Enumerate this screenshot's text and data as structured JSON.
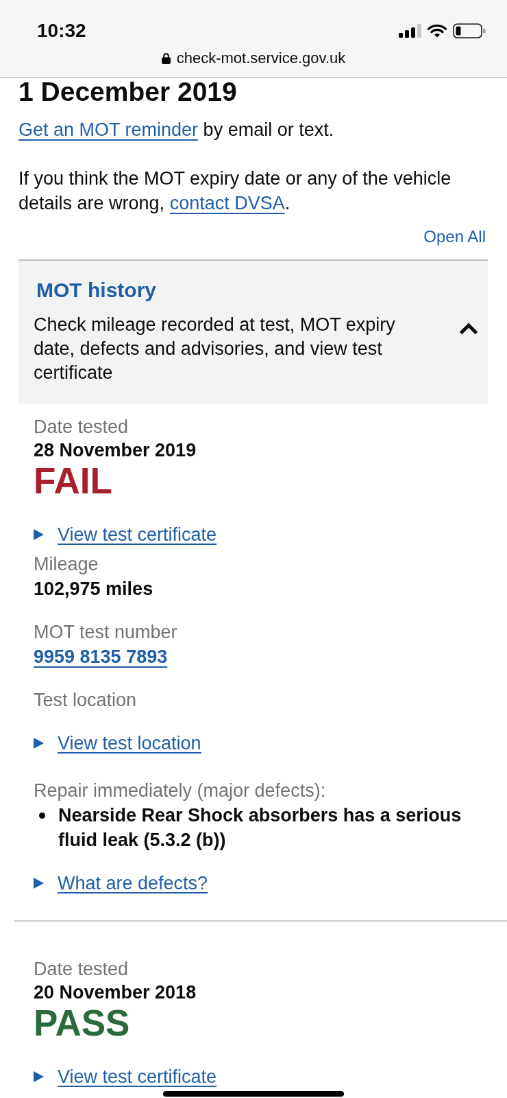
{
  "status_bar": {
    "time": "10:32"
  },
  "address_bar": {
    "url": "check-mot.service.gov.uk"
  },
  "intro": {
    "heading": "1 December 2019",
    "reminder": {
      "link": "Get an MOT reminder",
      "rest": "by email or text."
    },
    "contact": {
      "text": "If you think the MOT expiry date or any of the vehicle details are wrong,",
      "link": "contact DVSA",
      "end": "."
    },
    "open_all": "Open All"
  },
  "accordion": {
    "title": "MOT history",
    "summary": "Check mileage recorded at test, MOT expiry date, defects and advisories, and view test certificate",
    "expanded": true,
    "tests": [
      {
        "date_label": "Date tested",
        "date": "28 November 2019",
        "result": {
          "text": "FAIL",
          "kind": "fail"
        },
        "details": [
          {
            "kind": "disclosure",
            "text": "View test certificate",
            "expanded": false
          },
          {
            "kind": "field",
            "label": "Mileage",
            "value": "102,975 miles"
          },
          {
            "kind": "link_field",
            "label": "MOT test number",
            "value": "9959 8135 7893"
          },
          {
            "kind": "label",
            "label": "Test location"
          },
          {
            "kind": "disclosure",
            "text": "View test location",
            "expanded": false
          },
          {
            "kind": "defects",
            "label": "Repair immediately (major defects):",
            "items": [
              "Nearside Rear Shock absorbers has a serious fluid leak (5.3.2 (b))"
            ]
          },
          {
            "kind": "disclosure",
            "text": "What are defects?",
            "expanded": false
          }
        ]
      },
      {
        "date_label": "Date tested",
        "date": "20 November 2018",
        "result": {
          "text": "PASS",
          "kind": "pass"
        },
        "details": [
          {
            "kind": "disclosure",
            "text": "View test certificate",
            "expanded": false
          }
        ]
      }
    ]
  }
}
